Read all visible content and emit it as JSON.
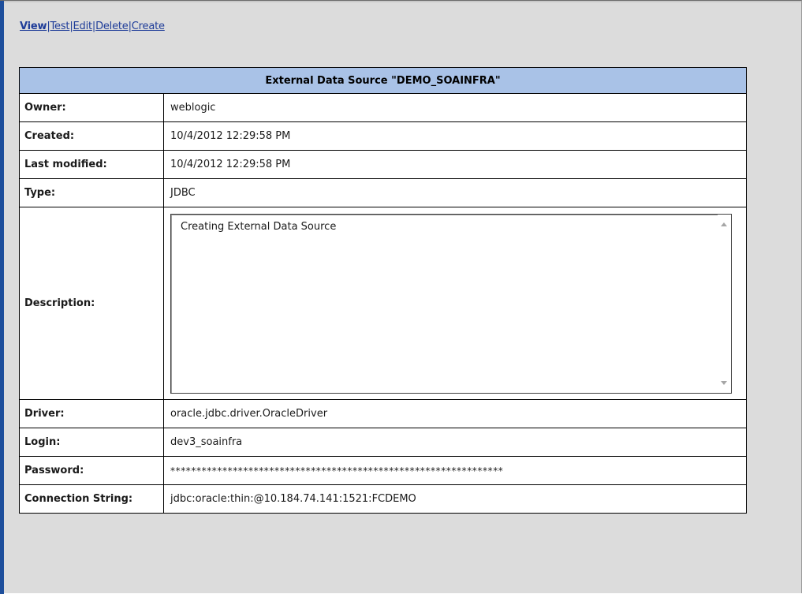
{
  "actions": {
    "view": "View",
    "test": "Test",
    "edit": "Edit",
    "delete": "Delete",
    "create": "Create",
    "separator": "|"
  },
  "datasource": {
    "title": "External Data Source \"DEMO_SOAINFRA\"",
    "rows": {
      "owner": {
        "label": "Owner:",
        "value": "weblogic"
      },
      "created": {
        "label": "Created:",
        "value": "10/4/2012 12:29:58 PM"
      },
      "last_modified": {
        "label": "Last modified:",
        "value": "10/4/2012 12:29:58 PM"
      },
      "type": {
        "label": "Type:",
        "value": "JDBC"
      },
      "description": {
        "label": "Description:",
        "value": "Creating External Data Source"
      },
      "driver": {
        "label": "Driver:",
        "value": "oracle.jdbc.driver.OracleDriver"
      },
      "login": {
        "label": "Login:",
        "value": "dev3_soainfra"
      },
      "password": {
        "label": "Password:",
        "value": "****************************************************************"
      },
      "connection_string": {
        "label": "Connection String:",
        "value": "jdbc:oracle:thin:@10.184.74.141:1521:FCDEMO"
      }
    }
  },
  "colors": {
    "header_bg": "#a9c2e7",
    "link": "#1f3d99",
    "frame_bg": "#dcdcdc",
    "left_bar": "#1e4f9c"
  }
}
